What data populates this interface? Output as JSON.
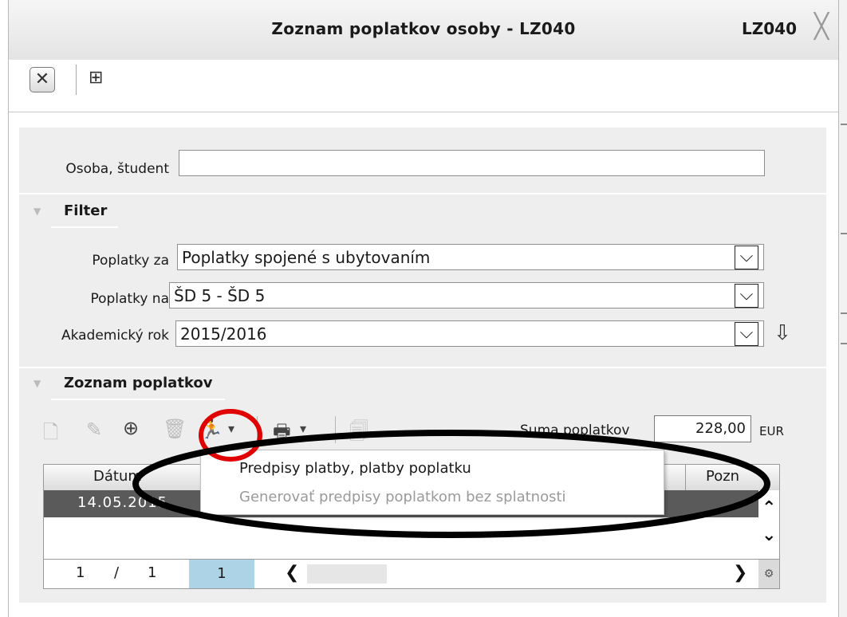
{
  "window": {
    "title": "Zoznam poplatkov osoby - LZ040",
    "code": "LZ040",
    "close_glyph": "╳"
  },
  "toolbar": {
    "close_glyph": "✕",
    "tree_glyph": "⊞"
  },
  "person": {
    "label": "Osoba, študent",
    "value": ""
  },
  "filter": {
    "title": "Filter",
    "fees_for_label": "Poplatky za",
    "fees_for_value": "Poplatky spojené s ubytovaním",
    "fees_on_label": "Poplatky na",
    "fees_on_value": "ŠD 5 - ŠD 5",
    "year_label": "Akademický rok",
    "year_value": "2015/2016",
    "dropdown_glyph": "⌵",
    "download_glyph": "⇩"
  },
  "list": {
    "title": "Zoznam poplatkov",
    "sum_label": "Suma poplatkov",
    "sum_value": "228,00",
    "sum_unit": "EUR",
    "icons": {
      "add": "🗋",
      "edit": "✎",
      "zoom": "⊕",
      "delete": "🗑",
      "run": "🏃",
      "print": "🖶",
      "export": "🗐",
      "caret": "▾"
    },
    "columns": [
      "Dátum",
      "Pozn"
    ],
    "rows": [
      {
        "date": "14.05.2015"
      }
    ],
    "pagination": {
      "current": "1",
      "slash": "/",
      "total": "1",
      "page": "1",
      "prev_glyph": "❮",
      "next_glyph": "❯",
      "gear_glyph": "⚙",
      "up_glyph": "⌃",
      "down_glyph": "⌄"
    }
  },
  "menu": {
    "items": [
      {
        "label": "Predpisy platby, platby poplatku",
        "enabled": true
      },
      {
        "label": "Generovať predpisy poplatkom bez splatnosti",
        "enabled": false
      }
    ]
  },
  "annotations": {
    "red_color": "#e00000",
    "black_color": "#000000"
  }
}
